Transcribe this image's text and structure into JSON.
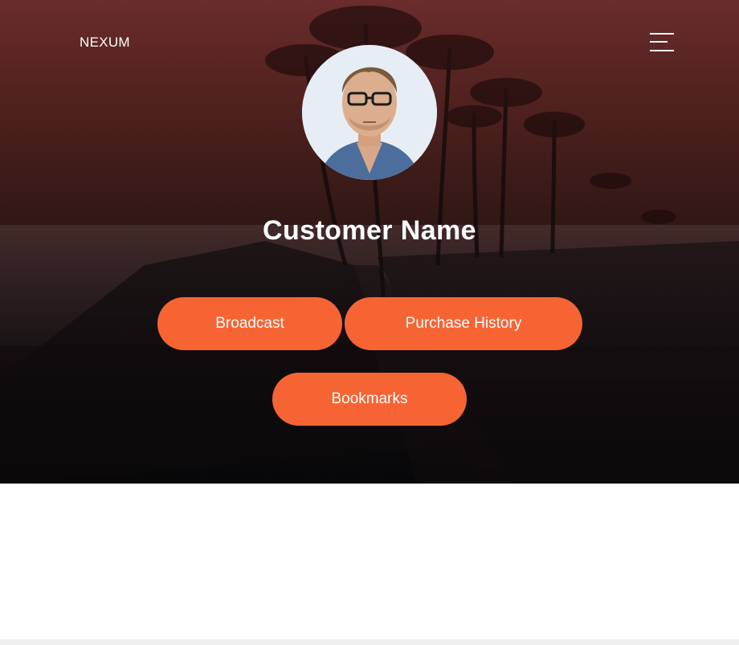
{
  "header": {
    "brand": "NEXUM",
    "menu_icon": "hamburger-menu-icon"
  },
  "profile": {
    "avatar_icon": "profile-photo",
    "name": "Customer Name"
  },
  "actions": {
    "broadcast": "Broadcast",
    "purchase_history": "Purchase History",
    "bookmarks": "Bookmarks"
  },
  "colors": {
    "accent": "#f76434",
    "hero_top": "#6a2c2c",
    "hero_bottom": "#0f0f14",
    "text_on_dark": "#ffffff"
  }
}
